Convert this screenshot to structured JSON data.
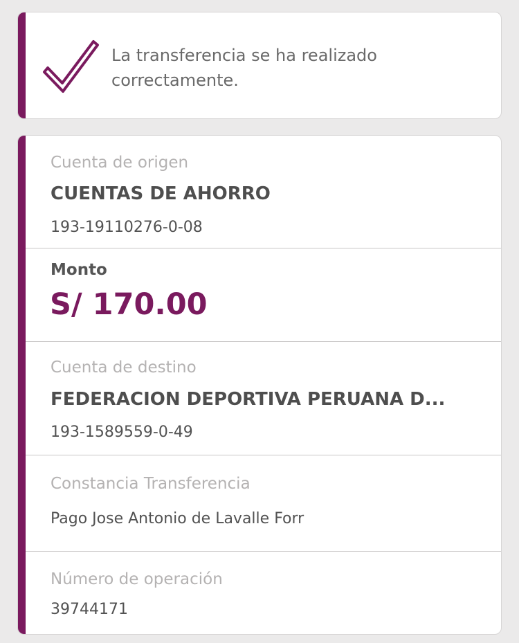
{
  "success": {
    "message": "La transferencia se ha realizado correctamente.",
    "icon": "check-icon",
    "accent_color": "#7a1a5e"
  },
  "details": {
    "origin": {
      "label": "Cuenta de origen",
      "account_type": "CUENTAS DE AHORRO",
      "account_number": "193-19110276-0-08"
    },
    "amount": {
      "label": "Monto",
      "value": "S/ 170.00"
    },
    "destination": {
      "label": "Cuenta de destino",
      "name": "FEDERACION DEPORTIVA PERUANA D...",
      "account_number": "193-1589559-0-49"
    },
    "receipt": {
      "label": "Constancia Transferencia",
      "value": "Pago Jose Antonio de Lavalle Forr"
    },
    "operation": {
      "label": "Número de operación",
      "value": "39744171"
    }
  }
}
